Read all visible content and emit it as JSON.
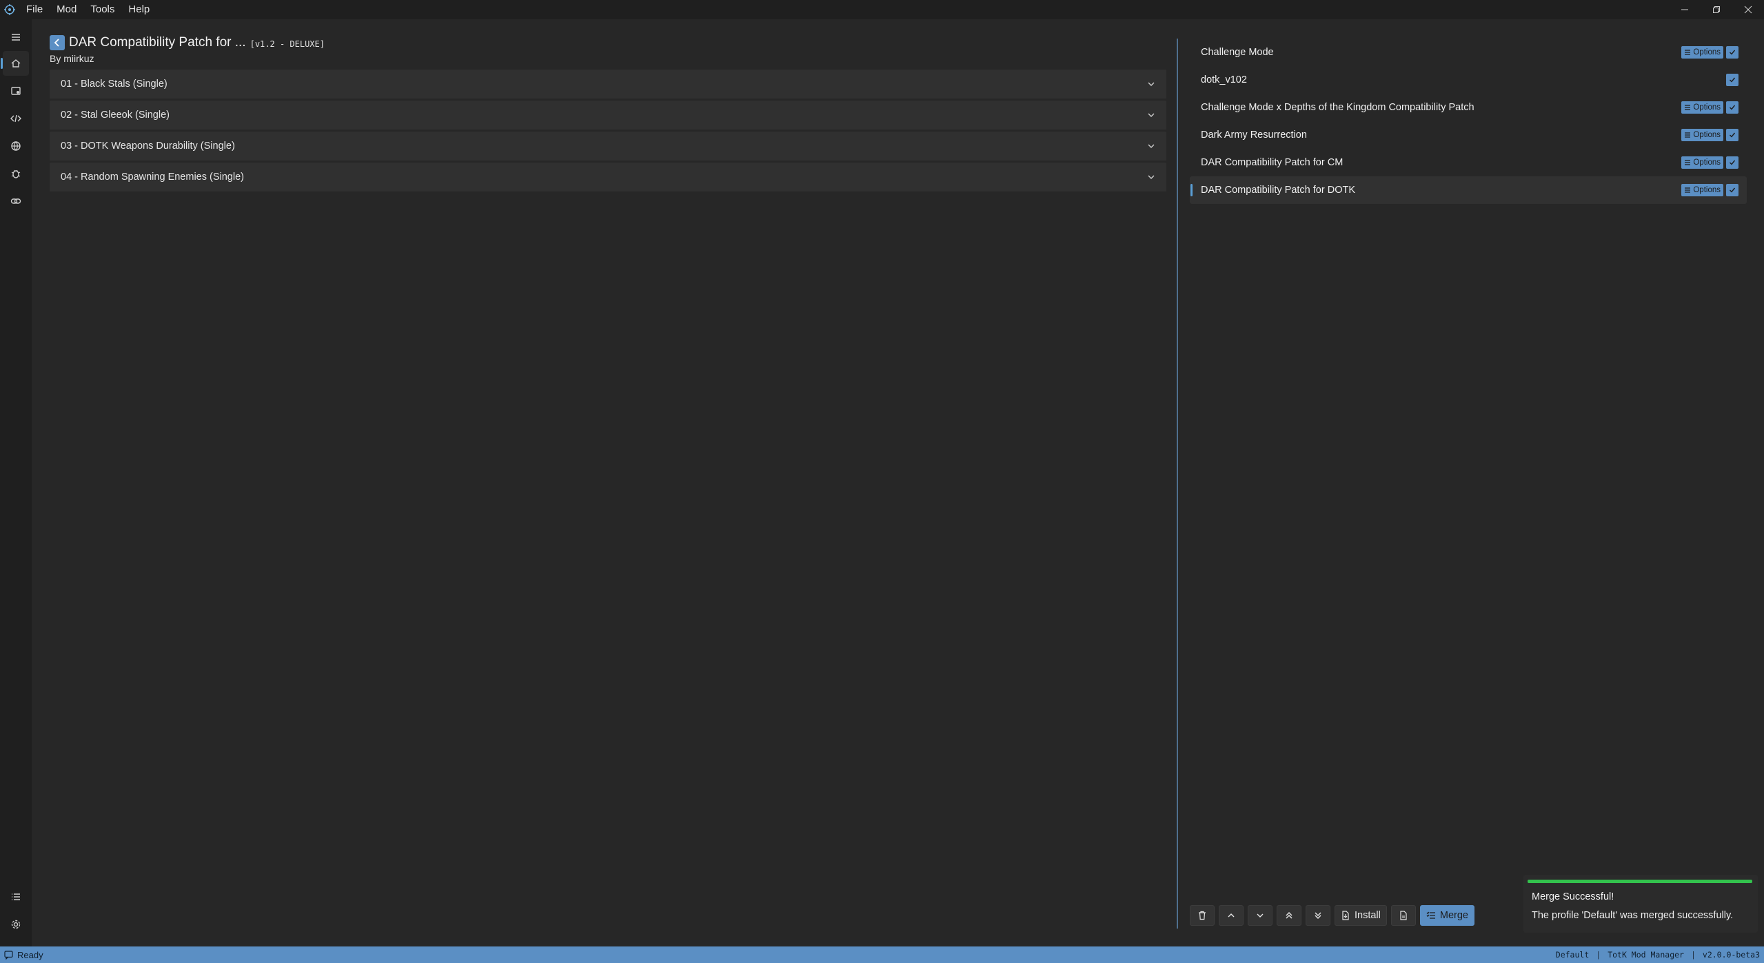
{
  "menu": {
    "items": [
      "File",
      "Mod",
      "Tools",
      "Help"
    ]
  },
  "rail": {
    "top_icons": [
      "home-icon",
      "mods-database-icon",
      "code-icon",
      "globe-icon",
      "bug-icon",
      "link-icon"
    ],
    "bottom_icons": [
      "list-icon",
      "settings-icon"
    ]
  },
  "detail": {
    "title": "DAR Compatibility Patch for ...",
    "version": "[v1.2 - DELUXE]",
    "author": "By miirkuz",
    "groups": [
      "01 - Black Stals (Single)",
      "02 - Stal Gleeok (Single)",
      "03 - DOTK Weapons Durability (Single)",
      "04 - Random Spawning Enemies (Single)"
    ]
  },
  "mods": [
    {
      "name": "Challenge Mode",
      "has_options": true,
      "enabled": true
    },
    {
      "name": "dotk_v102",
      "has_options": false,
      "enabled": true
    },
    {
      "name": "Challenge Mode x Depths of the Kingdom Compatibility Patch",
      "has_options": true,
      "enabled": true
    },
    {
      "name": "Dark Army Resurrection",
      "has_options": true,
      "enabled": true
    },
    {
      "name": "DAR Compatibility Patch for CM",
      "has_options": true,
      "enabled": true
    },
    {
      "name": "DAR Compatibility Patch for DOTK",
      "has_options": true,
      "enabled": true,
      "selected": true
    }
  ],
  "options_label": "Options",
  "toolbar": {
    "install_label": "Install",
    "merge_label": "Merge"
  },
  "toast": {
    "title": "Merge Successful!",
    "message": "The profile 'Default' was merged successfully."
  },
  "status": {
    "text": "Ready",
    "profile": "Default",
    "app_name": "TotK Mod Manager",
    "version": "v2.0.0-beta3"
  },
  "colors": {
    "accent": "#5b8fc4",
    "success": "#33c24d",
    "background": "#272727"
  }
}
